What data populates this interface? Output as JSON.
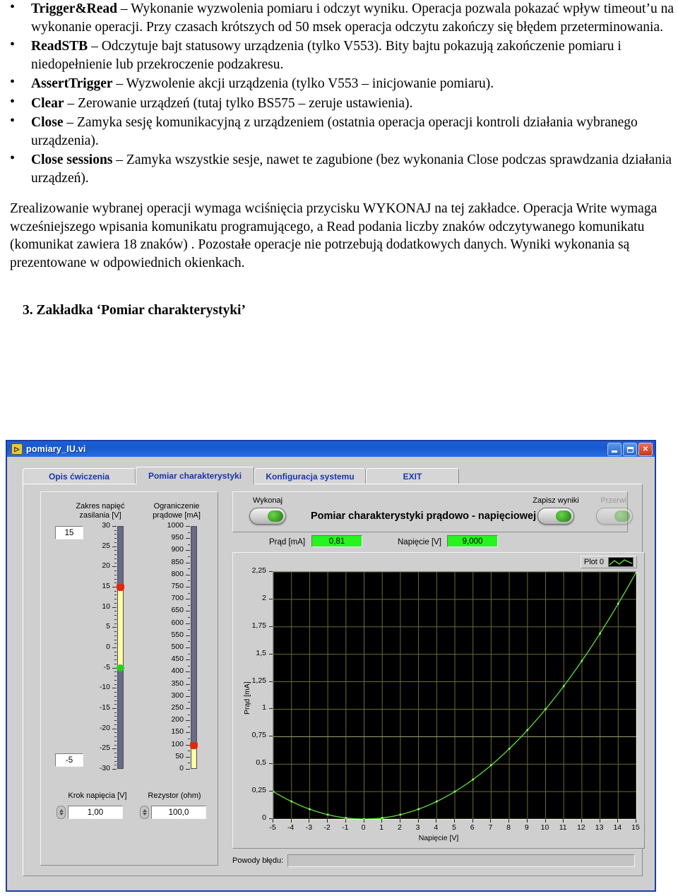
{
  "document": {
    "bullets": [
      {
        "term": "Trigger&Read",
        "text": " – Wykonanie wyzwolenia pomiaru i odczyt wyniku. Operacja pozwala pokazać wpływ timeout’u na wykonanie operacji. Przy czasach krótszych od 50 msek operacja odczytu zakończy się błędem przeterminowania."
      },
      {
        "term": "ReadSTB",
        "text": " –  Odczytuje bajt statusowy urządzenia (tylko V553). Bity bajtu pokazują zakończenie pomiaru i niedopełnienie lub przekroczenie podzakresu."
      },
      {
        "term": "AssertTrigger",
        "text": " –  Wyzwolenie akcji urządzenia (tylko V553 – inicjowanie pomiaru)."
      },
      {
        "term": "Clear",
        "text": " –  Zerowanie urządzeń (tutaj tylko BS575 – zeruje ustawienia)."
      },
      {
        "term": "Close",
        "text": " –  Zamyka sesję komunikacyjną z urządzeniem (ostatnia operacja operacji kontroli działania wybranego urządzenia)."
      },
      {
        "term": "Close sessions",
        "text": " – Zamyka wszystkie sesje, nawet te zagubione (bez wykonania Close podczas sprawdzania działania urządzeń)."
      }
    ],
    "paragraph": "Zrealizowanie wybranej operacji wymaga wciśnięcia przycisku WYKONAJ na tej zakładce. Operacja Write  wymaga wcześniejszego wpisania komunikatu programującego, a Read  podania liczby znaków odczytywanego komunikatu (komunikat zawiera 18 znaków) . Pozostałe operacje nie potrzebują dodatkowych danych. Wyniki wykonania są prezentowane w odpowiednich okienkach.",
    "section_heading": "3. Zakładka ‘Pomiar charakterystyki’"
  },
  "window": {
    "title": "pomiary_IU.vi",
    "icon": "labview-vi-icon",
    "buttons": {
      "minimize": "minimize-button",
      "maximize": "maximize-button",
      "close": "close-button"
    },
    "accent_titlebar": "#1f5fd8"
  },
  "tabs": [
    {
      "label": "Opis ćwiczenia",
      "active": false
    },
    {
      "label": "Pomiar charakterystyki",
      "active": true
    },
    {
      "label": "Konfiguracja systemu",
      "active": false
    },
    {
      "label": "EXIT",
      "active": false
    }
  ],
  "controls": {
    "voltage_range": {
      "label_line1": "Zakres  napięć",
      "label_line2": "zasilania  [V]",
      "max_value": "15",
      "min_value": "-5",
      "scale_labels": [
        "30",
        "25",
        "20",
        "15",
        "10",
        "5",
        "0",
        "-5",
        "-10",
        "-15",
        "-20",
        "-25",
        "-30"
      ],
      "scale_max": 30,
      "scale_min": -30,
      "upper_thumb": 15,
      "lower_thumb": -5,
      "upper_thumb_color": "#e02a10",
      "lower_thumb_color": "#2ecc1e"
    },
    "current_limit": {
      "label_line1": "Ograniczenie",
      "label_line2": "prądowe [mA]",
      "scale_labels": [
        "1000",
        "950",
        "900",
        "850",
        "800",
        "750",
        "700",
        "650",
        "600",
        "550",
        "500",
        "450",
        "400",
        "350",
        "300",
        "250",
        "200",
        "150",
        "100",
        "50",
        "0"
      ],
      "scale_max": 1000,
      "scale_min": 0,
      "thumb": 100,
      "thumb_color": "#e02a10"
    },
    "voltage_step": {
      "label": "Krok napięcia [V]",
      "value": "1,00"
    },
    "resistor": {
      "label": "Rezystor (ohm)",
      "value": "100,0"
    }
  },
  "toolbar": {
    "run_label": "Wykonaj",
    "save_label": "Zapisz wyniki",
    "abort_label": "Przerwij",
    "title": "Pomiar charakterystyki prądowo - napięciowej"
  },
  "indicators": {
    "current": {
      "label": "Prąd [mA]",
      "value": "0,81",
      "color": "#27f31f"
    },
    "voltage": {
      "label": "Napięcie [V]",
      "value": "9,000",
      "color": "#27f31f"
    }
  },
  "legend": {
    "plot_name": "Plot 0"
  },
  "error": {
    "label": "Powody błędu:",
    "value": ""
  },
  "chart_data": {
    "type": "line",
    "title": "Pomiar charakterystyki prądowo - napięciowej",
    "xlabel": "Napięcie [V]",
    "ylabel": "Prąd [mA]",
    "xlim": [
      -5,
      15
    ],
    "ylim": [
      0,
      2.25
    ],
    "xticks": [
      -5,
      -4,
      -3,
      -2,
      -1,
      0,
      1,
      2,
      3,
      4,
      5,
      6,
      7,
      8,
      9,
      10,
      11,
      12,
      13,
      14,
      15
    ],
    "ytick_labels": [
      "0",
      "0,25",
      "0,5",
      "0,75",
      "1",
      "1,25",
      "1,5",
      "1,75",
      "2",
      "2,25"
    ],
    "yticks": [
      0,
      0.25,
      0.5,
      0.75,
      1,
      1.25,
      1.5,
      1.75,
      2,
      2.25
    ],
    "grid": true,
    "legend_position": "top-right",
    "background": "#000000",
    "line_color": "#5ee03c",
    "series": [
      {
        "name": "Plot 0",
        "x": [
          -5,
          -4,
          -3,
          -2,
          -1,
          0,
          1,
          2,
          3,
          4,
          5,
          6,
          7,
          8,
          9,
          10,
          11,
          12,
          13,
          14,
          15
        ],
        "y": [
          0.25,
          0.16,
          0.09,
          0.04,
          0.01,
          0.0,
          0.01,
          0.04,
          0.09,
          0.16,
          0.25,
          0.36,
          0.49,
          0.64,
          0.81,
          1.0,
          1.21,
          1.44,
          1.69,
          1.96,
          2.25
        ]
      }
    ]
  }
}
